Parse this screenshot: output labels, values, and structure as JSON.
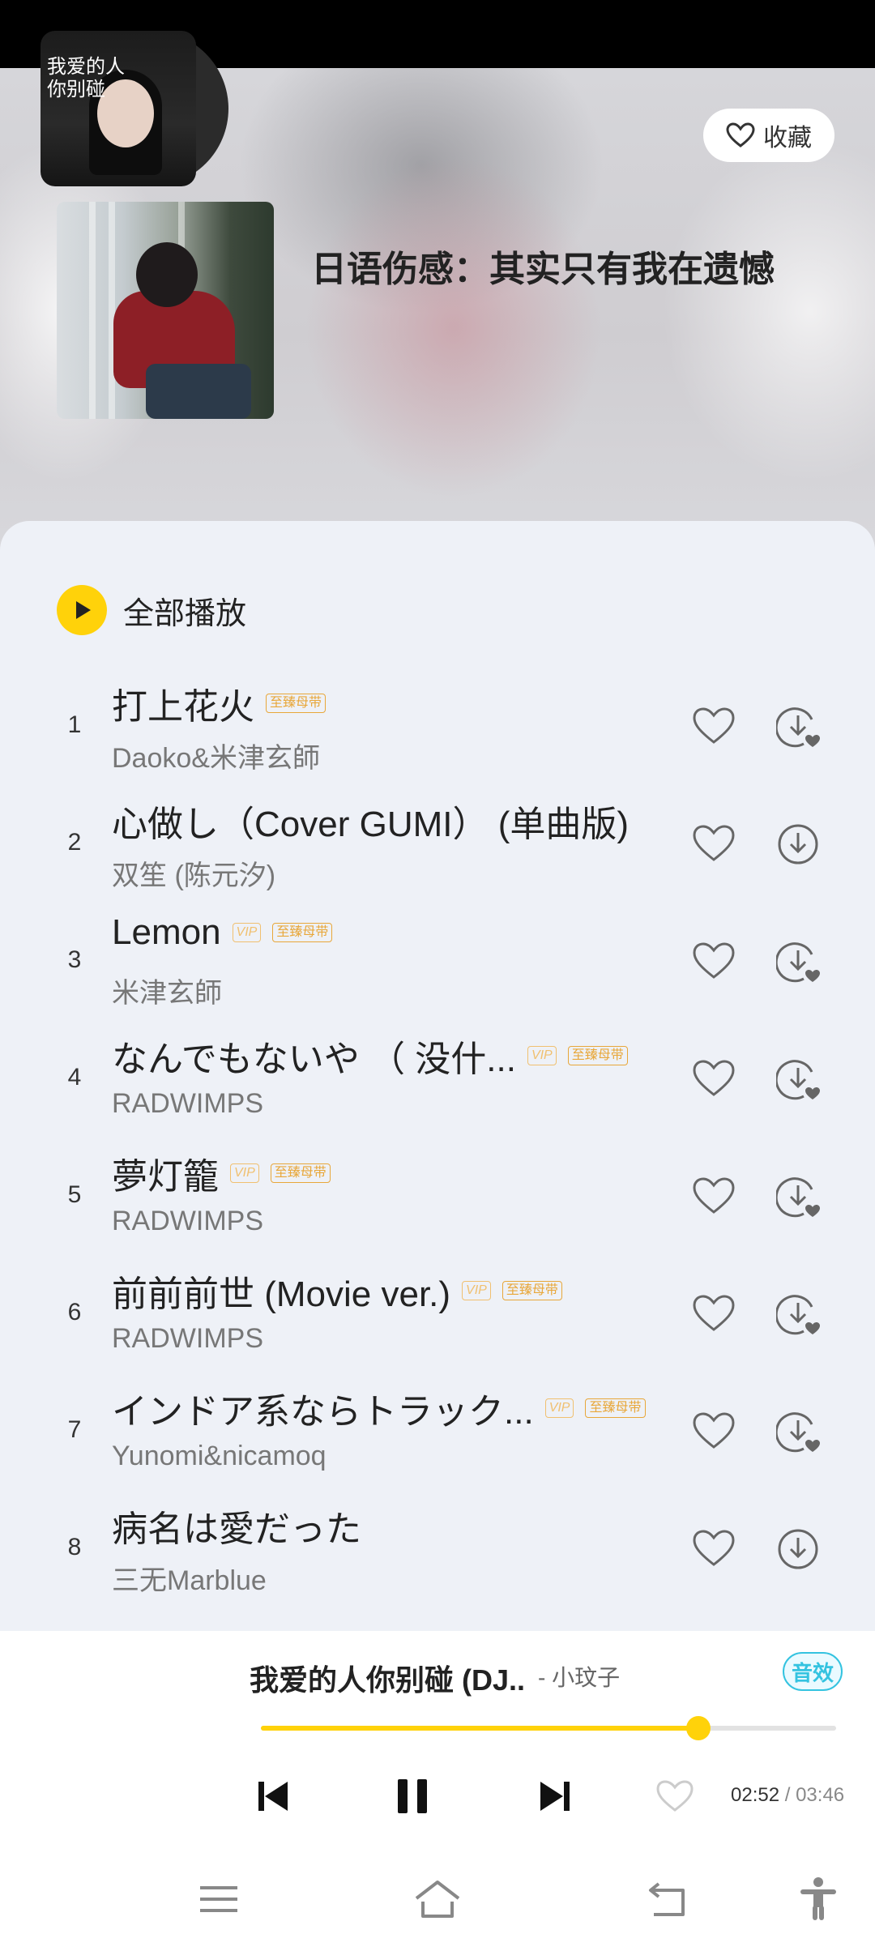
{
  "header": {
    "favorite_label": "收藏",
    "playlist_title": "日语伤感：其实只有我在遗憾"
  },
  "play_all": {
    "label": "全部播放"
  },
  "songs": [
    {
      "num": "1",
      "title": "打上花火",
      "vip": "",
      "badge": "至臻母带",
      "artist": "Daoko&米津玄師",
      "download": "downloaded"
    },
    {
      "num": "2",
      "title": "心做し（Cover GUMI） (单曲版)",
      "vip": "",
      "badge": "",
      "artist": "双笙 (陈元汐)",
      "download": "download"
    },
    {
      "num": "3",
      "title": "Lemon",
      "vip": "VIP",
      "badge": "至臻母带",
      "artist": "米津玄師",
      "download": "downloaded"
    },
    {
      "num": "4",
      "title": "なんでもないや （ 没什...",
      "vip": "VIP",
      "badge": "至臻母带",
      "artist": "RADWIMPS",
      "download": "downloaded"
    },
    {
      "num": "5",
      "title": "夢灯籠",
      "vip": "VIP",
      "badge": "至臻母带",
      "artist": "RADWIMPS",
      "download": "downloaded"
    },
    {
      "num": "6",
      "title": "前前前世 (Movie ver.)",
      "vip": "VIP",
      "badge": "至臻母带",
      "artist": "RADWIMPS",
      "download": "downloaded"
    },
    {
      "num": "7",
      "title": "インドア系ならトラック...",
      "vip": "VIP",
      "badge": "至臻母带",
      "artist": "Yunomi&nicamoq",
      "download": "downloaded"
    },
    {
      "num": "8",
      "title": "病名は愛だった",
      "vip": "",
      "badge": "",
      "artist": "三无Marblue",
      "download": "download"
    }
  ],
  "player": {
    "cover_text": "我爱的人你别碰",
    "title": "我爱的人你别碰 (DJ..",
    "artist": "- 小玟子",
    "effect_label": "音效",
    "progress": 0.76,
    "current_time": "02:52",
    "separator": " / ",
    "total_time": "03:46"
  },
  "colors": {
    "accent": "#ffd20a",
    "effect": "#34c3e0",
    "badge": "#e8a73a"
  }
}
